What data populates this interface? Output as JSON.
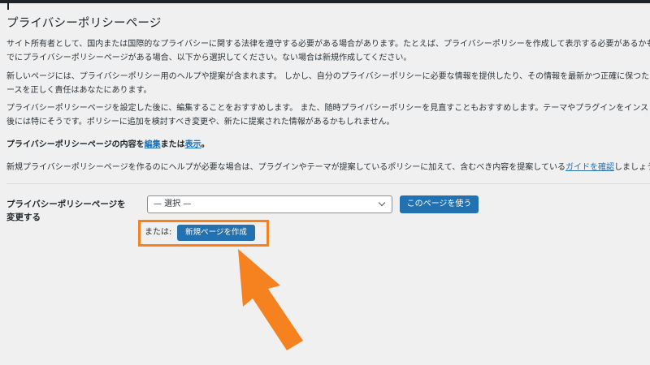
{
  "page": {
    "title": "プライバシーポリシーページ"
  },
  "intro": {
    "p1_line1": "サイト所有者として、国内または国際的なプライバシーに関する法律を遵守する必要がある場合があります。たとえば、プライバシーポリシーを作成して表示する必要があるかも",
    "p1_line2": "でにプライバシーポリシーページがある場合、以下から選択してください。ない場合は新規作成してください。",
    "p2_line1": "新しいページには、プライバシーポリシー用のヘルプや提案が含まれます。 しかし、自分のプライバシーポリシーに必要な情報を提供したり、その情報を最新かつ正確に保つため",
    "p2_line2": "ースを正しく責任はあなたにあります。",
    "p3_line1": "プライバシーポリシーページを設定した後に、編集することをおすすめします。 また、随時プライバシーポリシーを見直すこともおすすめします。テーマやプラグインをインスト",
    "p3_line2": "後には特にそうです。ポリシーに追加を検討すべき変更や、新たに提案された情報があるかもしれません。",
    "p4_prefix": "プライバシーポリシーページの内容を",
    "p4_edit_link": "編集",
    "p4_middle": "または",
    "p4_view_link": "表示",
    "p4_suffix": "。",
    "p5_prefix": "新規プライバシーポリシーページを作るのにヘルプが必要な場合は、プラグインやテーマが提案しているポリシーに加えて、含むべき内容を提案している",
    "p5_link": "ガイドを確認",
    "p5_suffix": "しましょう"
  },
  "form": {
    "label_line1": "プライバシーポリシーページを",
    "label_line2": "変更する",
    "select_value": "— 選択 —",
    "use_button": "このページを使う",
    "or_label": "または:",
    "create_button": "新規ページを作成"
  },
  "colors": {
    "primary_button": "#2271b1",
    "highlight": "#f5821f",
    "background": "#f0f0f1"
  },
  "icons": {
    "select_chevron": "chevron-down-icon",
    "annotation_arrow": "arrow-up-left-icon"
  }
}
